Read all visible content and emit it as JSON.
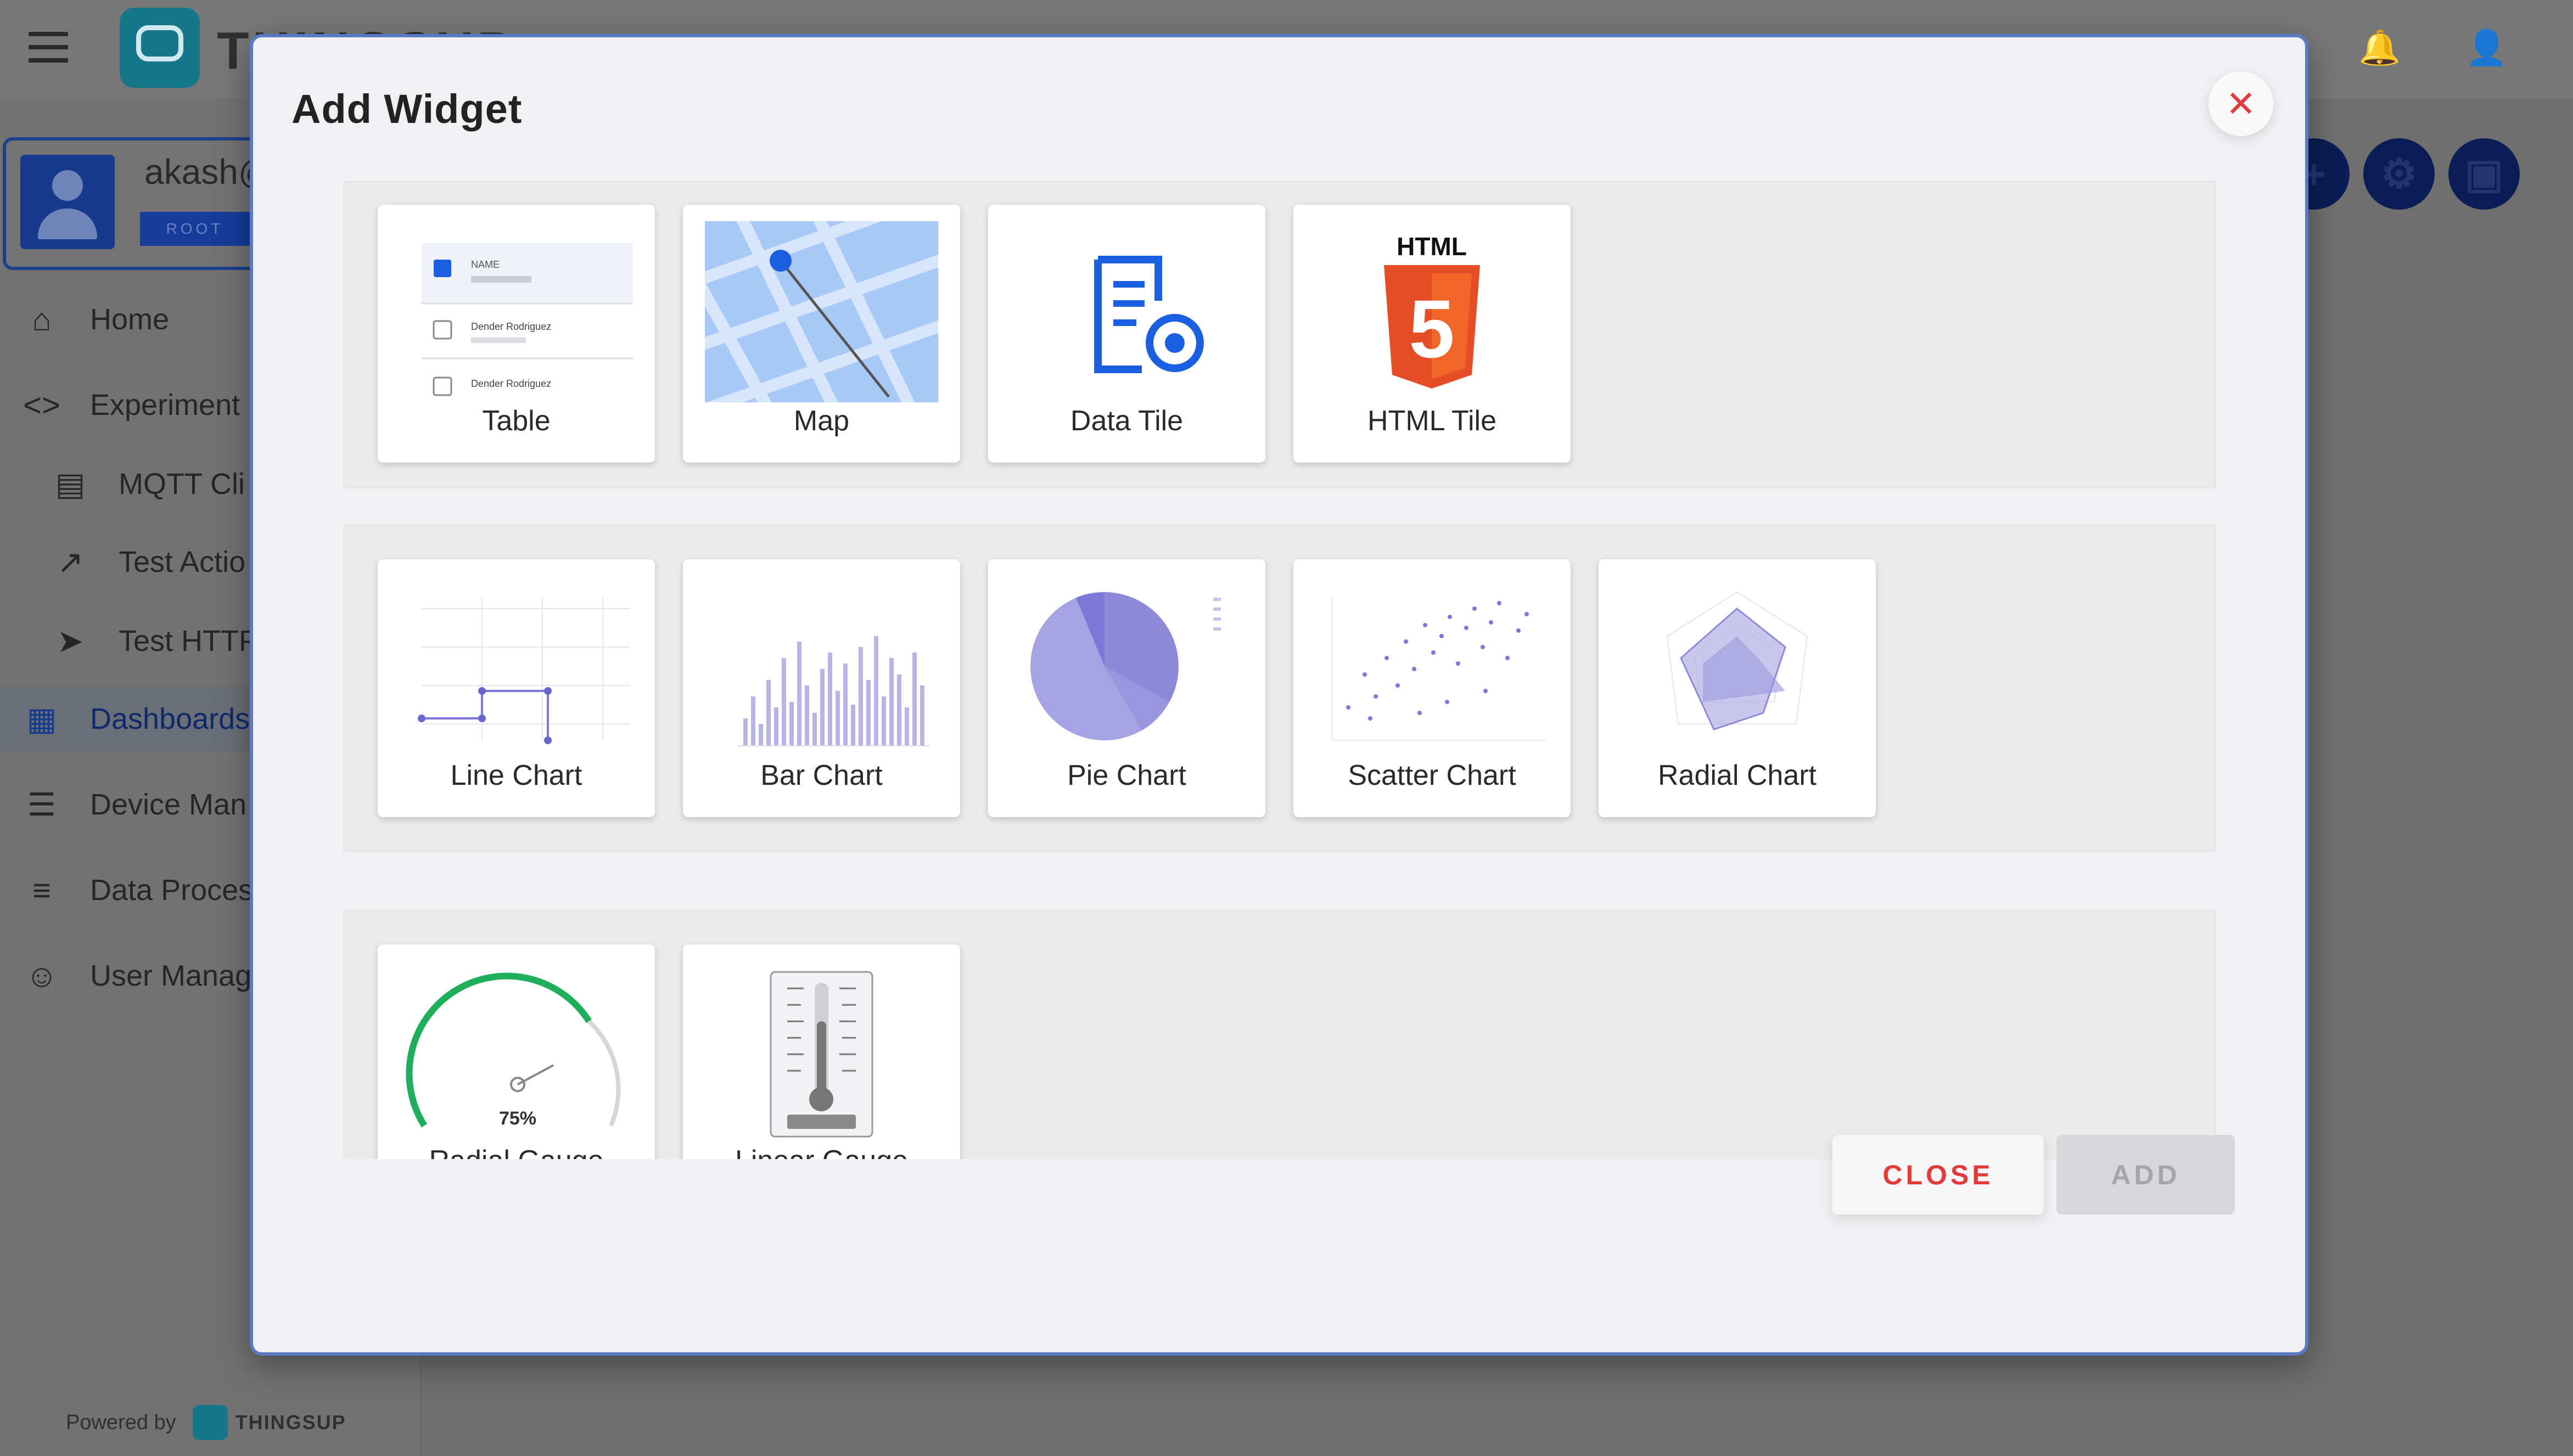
{
  "app": {
    "brand": "THINGSUP",
    "user_name": "akash@",
    "user_role": "ROOT",
    "powered_by": "Powered by",
    "powered_brand": "THINGSUP"
  },
  "sidebar": {
    "items": [
      {
        "label": "Home",
        "icon": "home-icon"
      },
      {
        "label": "Experiment",
        "icon": "code-icon"
      },
      {
        "label": "MQTT Cli",
        "icon": "clipboard-icon"
      },
      {
        "label": "Test Actio",
        "icon": "external-link-icon"
      },
      {
        "label": "Test HTTP",
        "icon": "send-icon"
      },
      {
        "label": "Dashboards",
        "icon": "dashboard-icon"
      },
      {
        "label": "Device Man",
        "icon": "tune-icon"
      },
      {
        "label": "Data Proces",
        "icon": "list-icon"
      },
      {
        "label": "User Manag",
        "icon": "users-icon"
      }
    ]
  },
  "modal": {
    "title": "Add Widget",
    "close_label": "CLOSE",
    "add_label": "ADD",
    "sections": [
      {
        "widgets": [
          "Table",
          "Map",
          "Data Tile",
          "HTML Tile"
        ]
      },
      {
        "widgets": [
          "Line Chart",
          "Bar Chart",
          "Pie Chart",
          "Scatter Chart",
          "Radial Chart"
        ]
      },
      {
        "widgets": [
          "Radial Gauge",
          "Linear Gauge"
        ]
      }
    ],
    "thumb_text": {
      "html_badge": "HTML",
      "html_number": "5",
      "gauge_value": "75%",
      "table_header": "NAME",
      "table_row1": "Dender Rodriguez",
      "table_row2": "Dender Rodriguez"
    }
  },
  "colors": {
    "accent_blue": "#1a5fe0",
    "close_red": "#e23b3b",
    "chart_purple": "#7d78d8",
    "gauge_green": "#1fae5b",
    "html_orange": "#e44d26"
  }
}
